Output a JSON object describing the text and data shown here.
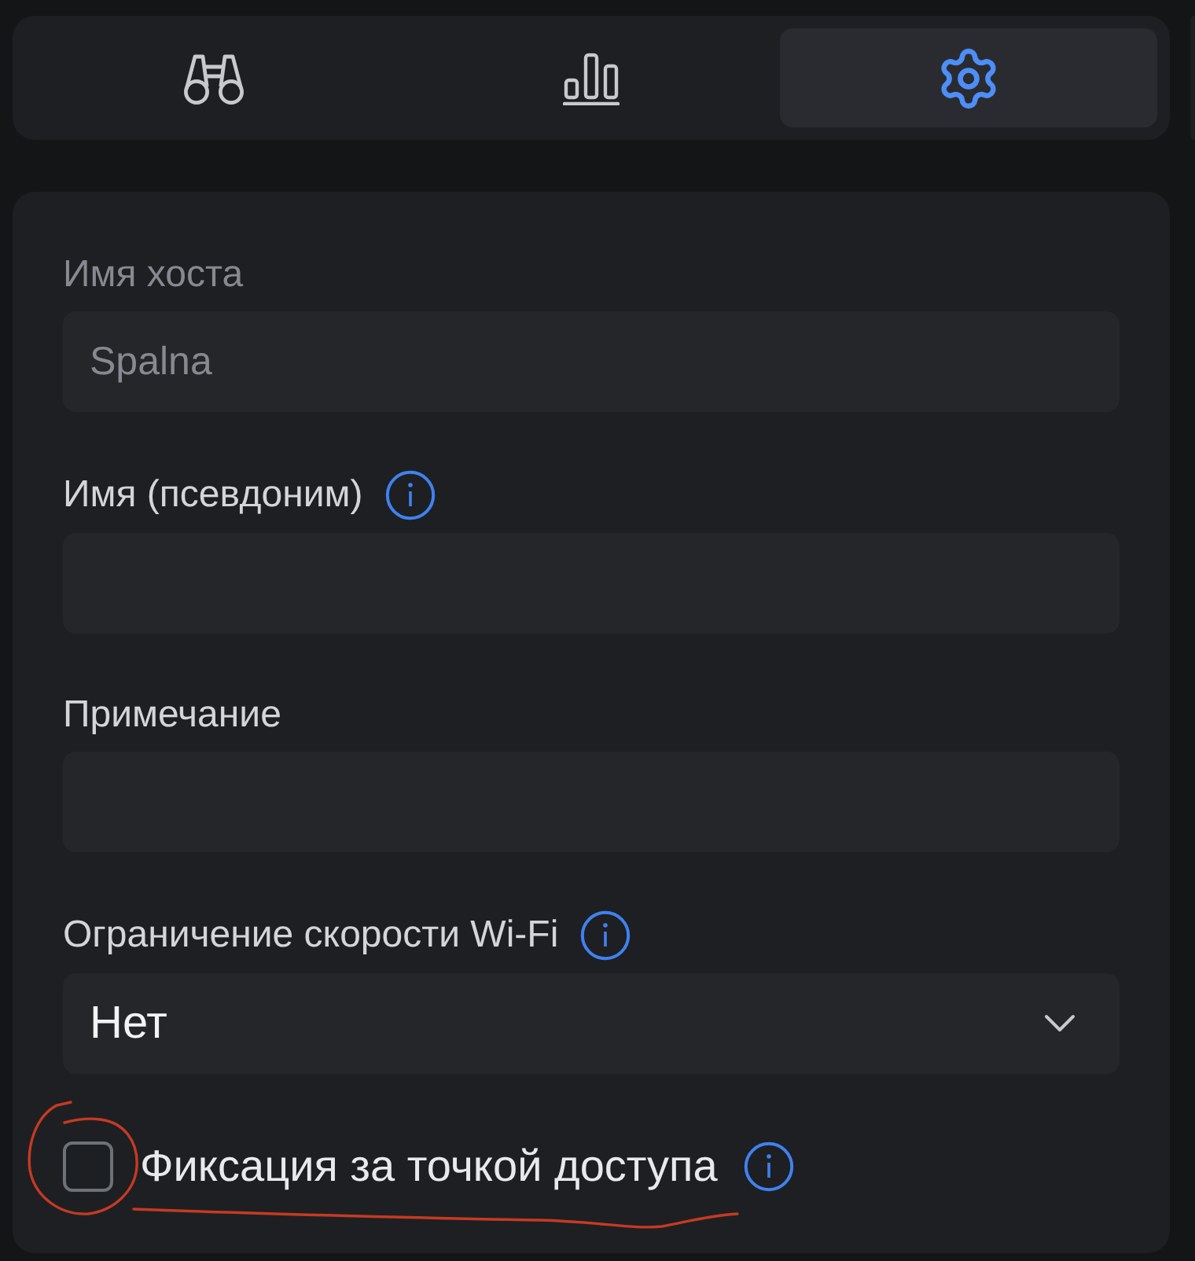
{
  "tabs": [
    {
      "kind": "search",
      "selected": false
    },
    {
      "kind": "stats",
      "selected": false
    },
    {
      "kind": "settings",
      "selected": true
    }
  ],
  "form": {
    "fields": [
      {
        "kind": "text",
        "label": "Имя хоста",
        "value": "Spalna",
        "disabled": true,
        "info": false
      },
      {
        "kind": "text",
        "label": "Имя (псевдоним)",
        "disabled": false,
        "info": true
      },
      {
        "kind": "text",
        "label": "Примечание",
        "disabled": false,
        "info": false
      },
      {
        "kind": "select",
        "label": "Ограничение скорости Wi-Fi",
        "value": "Нет",
        "info": true
      },
      {
        "kind": "checkbox",
        "label": "Фиксация за точкой доступа",
        "checked": false,
        "info": true,
        "circled": true,
        "underlined": true
      }
    ]
  }
}
